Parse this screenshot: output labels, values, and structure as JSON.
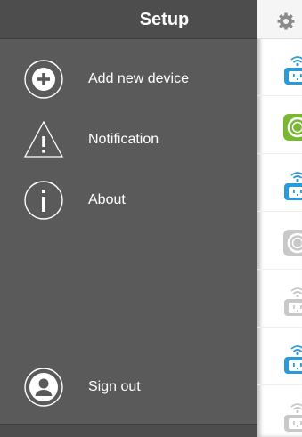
{
  "menu": {
    "title": "Setup",
    "items": [
      {
        "label": "Add new device",
        "icon": "plus-icon"
      },
      {
        "label": "Notification",
        "icon": "warning-icon"
      },
      {
        "label": "About",
        "icon": "info-icon"
      }
    ],
    "sign_out": {
      "label": "Sign out",
      "icon": "user-icon"
    }
  },
  "device_list": {
    "header_icon": "gear-icon",
    "devices": [
      {
        "kind": "smart-plug",
        "state": "online",
        "color": "#2a9ad8"
      },
      {
        "kind": "sensor",
        "state": "on",
        "color": "#7ab833"
      },
      {
        "kind": "smart-plug",
        "state": "online",
        "color": "#2a9ad8"
      },
      {
        "kind": "sensor",
        "state": "offline",
        "color": "#c8c8c8"
      },
      {
        "kind": "smart-plug",
        "state": "offline",
        "color": "#c8c8c8"
      },
      {
        "kind": "smart-plug",
        "state": "online",
        "color": "#2a9ad8"
      },
      {
        "kind": "smart-plug",
        "state": "offline",
        "color": "#c8c8c8"
      }
    ]
  },
  "colors": {
    "menu_bg": "#5a5a5a",
    "menu_header_bg": "#4d4d4d",
    "text": "#ffffff"
  }
}
